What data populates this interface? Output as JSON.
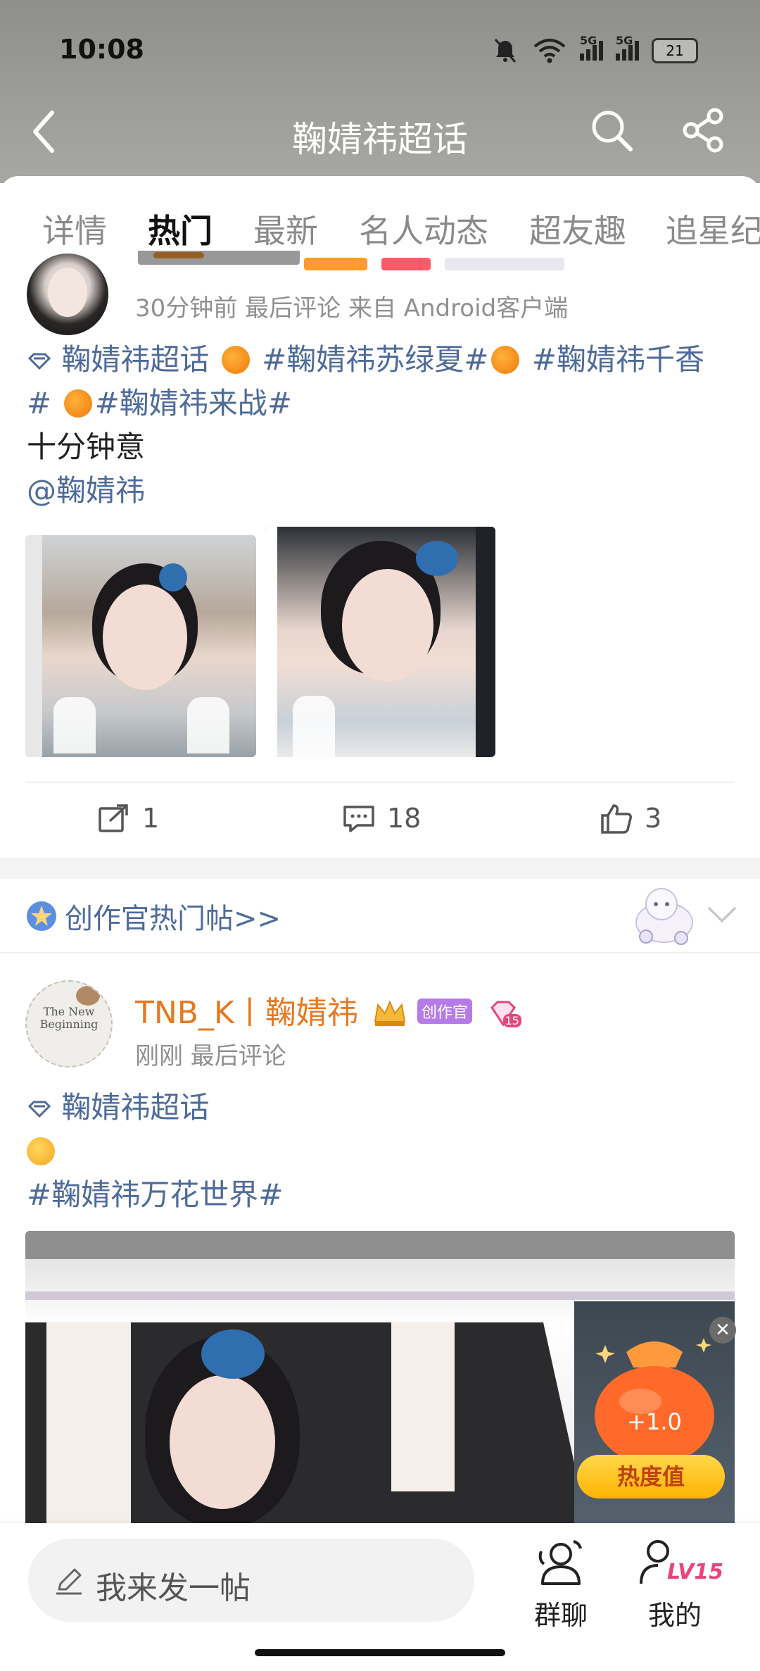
{
  "status_bar": {
    "time": "10:08",
    "net1": "5G",
    "net2": "5G",
    "battery": "21"
  },
  "nav": {
    "title": "鞠婧祎超话"
  },
  "tabs": [
    {
      "label": "详情"
    },
    {
      "label": "热门"
    },
    {
      "label": "最新"
    },
    {
      "label": "名人动态"
    },
    {
      "label": "超友趣"
    },
    {
      "label": "追星纪"
    }
  ],
  "active_tab": "热门",
  "post1": {
    "meta": "30分钟前 最后评论   来自 Android客户端",
    "supertopic": "鞠婧祎超话",
    "tag1": "#鞠婧祎苏绿夏#",
    "tag2": "#鞠婧祎千香",
    "tag2_end": "#",
    "tag3": "#鞠婧祎来战#",
    "body": "十分钟意",
    "mention": "@鞠婧祎",
    "actions": {
      "repost": "1",
      "comment": "18",
      "like": "3"
    }
  },
  "creator_section": {
    "label": "创作官热门帖>>"
  },
  "post2": {
    "author": "TNB_K丨鞠婧祎",
    "badge_creator": "创作官",
    "badge_level": "15",
    "meta": "刚刚 最后评论",
    "supertopic": "鞠婧祎超话",
    "tag": "#鞠婧祎万花世界#",
    "avatar_text": "The New Beginning"
  },
  "reward": {
    "value": "+1.0",
    "label": "热度值"
  },
  "bottom_bar": {
    "post_placeholder": "我来发一帖",
    "group_chat": "群聊",
    "mine": "我的",
    "level": "LV15"
  },
  "colors": {
    "accent": "#ff8200",
    "link": "#4e6b9a",
    "author": "#e8781f"
  }
}
